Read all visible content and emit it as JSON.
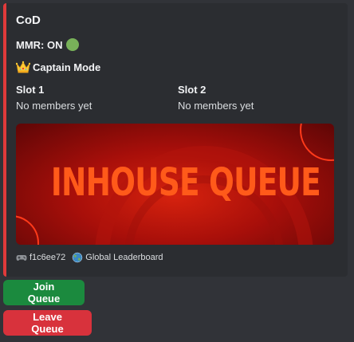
{
  "embed": {
    "title": "CoD",
    "mmr_label": "MMR: ON",
    "mmr_status_icon": "green-circle",
    "captain_icon": "crown",
    "captain_label": "Captain Mode",
    "slots": [
      {
        "name": "Slot 1",
        "value": "No members yet"
      },
      {
        "name": "Slot 2",
        "value": "No members yet"
      }
    ],
    "banner_text": "INHOUSE QUEUE",
    "accent_color": "#e03a3a",
    "footer": {
      "id_icon": "gamepad",
      "id_text": "f1c6ee72",
      "leaderboard_icon": "globe",
      "leaderboard_text": "Global Leaderboard"
    }
  },
  "buttons": {
    "join_label": "Join Queue",
    "join_color": "#1b8a3e",
    "leave_label": "Leave Queue",
    "leave_color": "#d8323c"
  }
}
